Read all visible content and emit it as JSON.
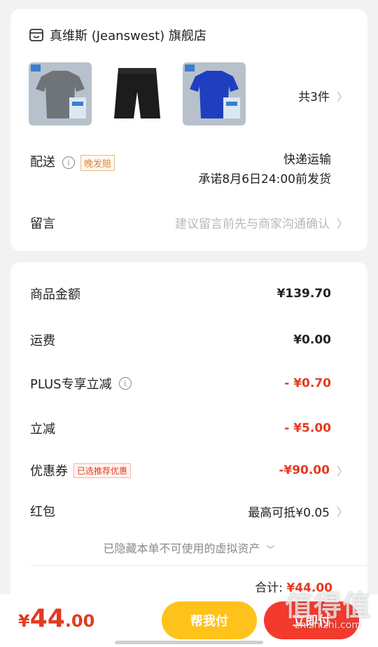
{
  "store": {
    "name": "真维斯 (Jeanswest) 旗舰店",
    "icon": "store-icon"
  },
  "products": {
    "items": [
      {
        "name": "gray-tshirt",
        "color": "#6f7479"
      },
      {
        "name": "black-shorts",
        "color": "#1c1c1c"
      },
      {
        "name": "blue-tshirt",
        "color": "#1f3fbf"
      }
    ],
    "count_label": "共3件"
  },
  "shipping": {
    "label": "配送",
    "tag": "晚发赔",
    "method": "快递运输",
    "promise": "承诺8月6日24:00前发货"
  },
  "memo": {
    "label": "留言",
    "placeholder": "建议留言前先与商家沟通确认"
  },
  "summary": {
    "goods_label": "商品金额",
    "goods_value": "¥139.70",
    "freight_label": "运费",
    "freight_value": "¥0.00",
    "plus_label": "PLUS专享立减",
    "plus_value": "- ¥0.70",
    "discount_label": "立减",
    "discount_value": "- ¥5.00",
    "coupon_label": "优惠券",
    "coupon_tag": "已选推荐优惠",
    "coupon_value": "-¥90.00",
    "redpacket_label": "红包",
    "redpacket_value": "最高可抵¥0.05",
    "hidden_note": "已隐藏本单不可使用的虚拟资产",
    "total_label": "合计:",
    "total_value": "¥44.00"
  },
  "footer": {
    "price_currency": "¥",
    "price_int": "44",
    "price_dec": ".00",
    "help_pay_label": "帮我付",
    "pay_label": "立即付"
  },
  "watermark": {
    "big": "值得值",
    "small": "zhizhizhi.com"
  },
  "colors": {
    "accent_red": "#e43a1f",
    "help_yellow": "#ffc21a",
    "pay_red": "#f33a2c"
  }
}
